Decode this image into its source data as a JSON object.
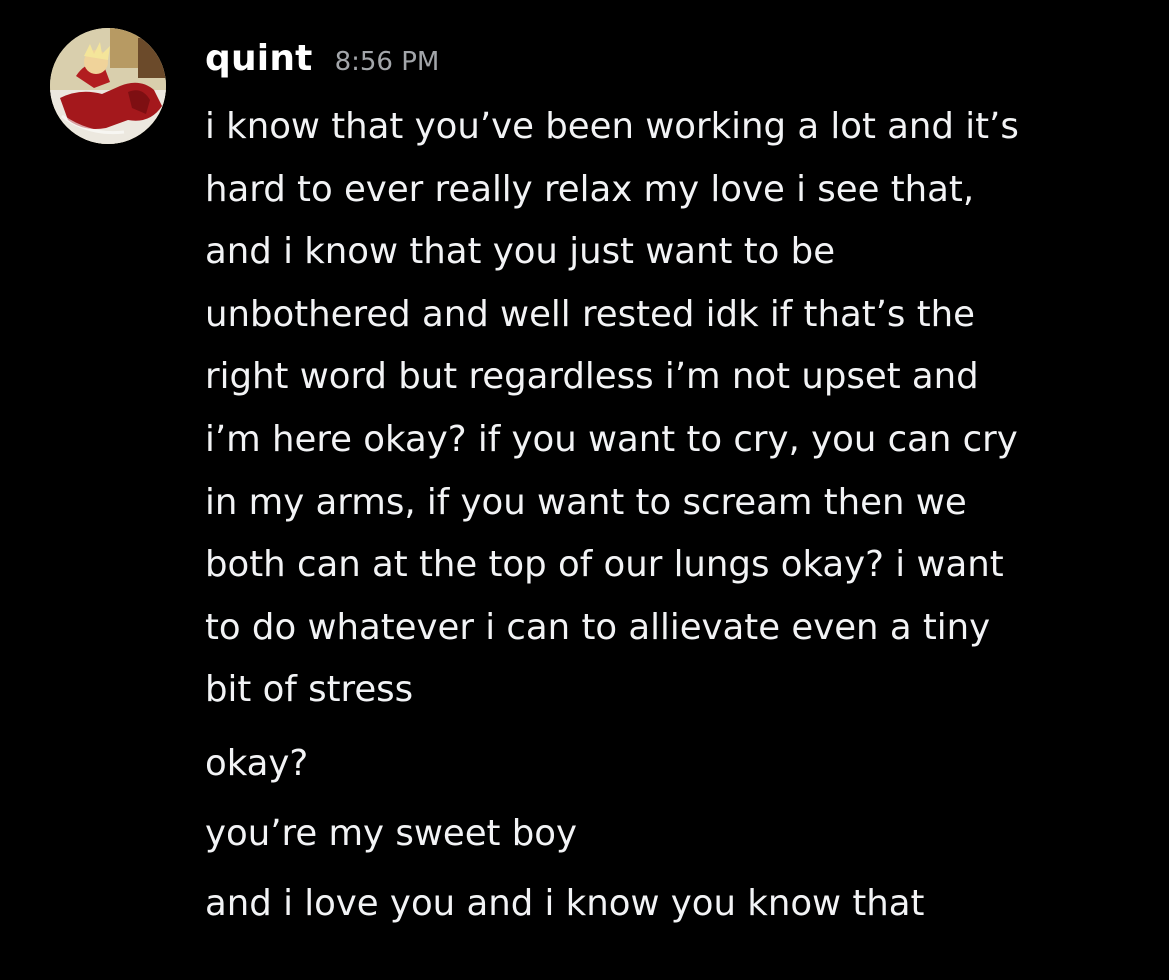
{
  "message": {
    "author": "quint",
    "timestamp": "8:56 PM",
    "body_lines": [
      "i know that you’ve been working a lot and it’s",
      "hard to ever really relax my love i see that,",
      "and i know that you just want to be",
      "unbothered and well rested idk if that’s the",
      "right word but regardless i’m not upset and",
      "i’m here okay? if you want to cry, you can cry",
      "in my arms, if you want to scream then we",
      "both can at the top of our lungs okay? i want",
      "to do whatever i can to allievate even a tiny",
      "bit of stress"
    ],
    "followups": [
      "okay?",
      "you’re my sweet boy",
      "and i love you and i know you know that"
    ]
  },
  "colors": {
    "background": "#000000",
    "text": "#f2f3f5",
    "username": "#ffffff",
    "timestamp": "#a3a6aa"
  },
  "icons": {
    "avatar": "user-avatar-image"
  }
}
